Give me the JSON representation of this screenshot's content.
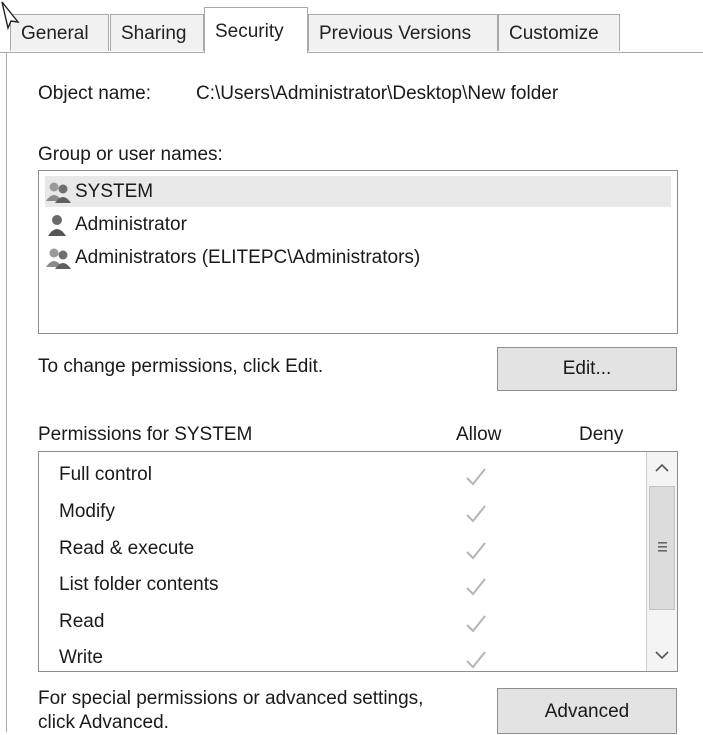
{
  "tabs": [
    {
      "label": "General"
    },
    {
      "label": "Sharing"
    },
    {
      "label": "Security"
    },
    {
      "label": "Previous Versions"
    },
    {
      "label": "Customize"
    }
  ],
  "object": {
    "label": "Object name:",
    "value": "C:\\Users\\Administrator\\Desktop\\New folder"
  },
  "groups": {
    "label": "Group or user names:",
    "items": [
      {
        "name": "SYSTEM",
        "icon": "group-users-icon"
      },
      {
        "name": "Administrator",
        "icon": "user-icon"
      },
      {
        "name": "Administrators (ELITEPC\\Administrators)",
        "icon": "group-users-icon"
      }
    ]
  },
  "change_hint": "To change permissions, click Edit.",
  "edit_button": "Edit...",
  "permissions": {
    "header": "Permissions for SYSTEM",
    "allow_header": "Allow",
    "deny_header": "Deny",
    "rows": [
      {
        "name": "Full control",
        "allow": true,
        "deny": false
      },
      {
        "name": "Modify",
        "allow": true,
        "deny": false
      },
      {
        "name": "Read & execute",
        "allow": true,
        "deny": false
      },
      {
        "name": "List folder contents",
        "allow": true,
        "deny": false
      },
      {
        "name": "Read",
        "allow": true,
        "deny": false
      },
      {
        "name": "Write",
        "allow": true,
        "deny": false
      }
    ]
  },
  "advanced": {
    "hint_line1": "For special permissions or advanced settings,",
    "hint_line2": "click Advanced.",
    "button": "Advanced"
  }
}
